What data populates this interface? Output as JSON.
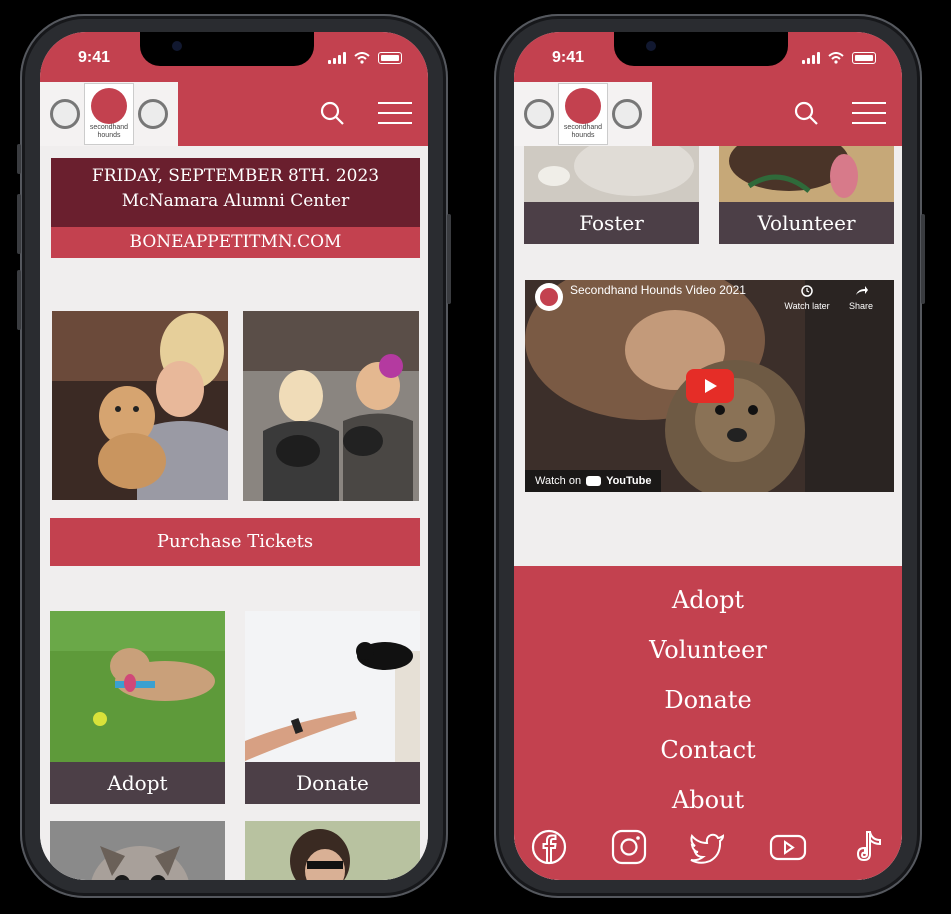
{
  "status_bar": {
    "time": "9:41"
  },
  "brand": {
    "name_line1": "secondhand",
    "name_line2": "hounds"
  },
  "event": {
    "date": "FRIDAY, SEPTEMBER 8TH. 2023",
    "venue": "McNamara Alumni Center",
    "url": "BONEAPPETITMN.COM"
  },
  "buttons": {
    "purchase_tickets": "Purchase Tickets"
  },
  "cards": {
    "adopt": "Adopt",
    "donate": "Donate",
    "foster": "Foster",
    "volunteer": "Volunteer"
  },
  "video": {
    "title": "Secondhand Hounds Video 2021",
    "watch_later": "Watch later",
    "share": "Share",
    "watch_on": "Watch on",
    "youtube": "YouTube"
  },
  "footer": {
    "links": [
      "Adopt",
      "Volunteer",
      "Donate",
      "Contact",
      "About"
    ]
  },
  "social": [
    "facebook-icon",
    "instagram-icon",
    "twitter-icon",
    "youtube-icon",
    "tiktok-icon"
  ],
  "colors": {
    "brand_red": "#c3414f",
    "dark_maroon": "#6a1f2e",
    "card_label": "#4c3f47",
    "background": "#f0eeee"
  }
}
